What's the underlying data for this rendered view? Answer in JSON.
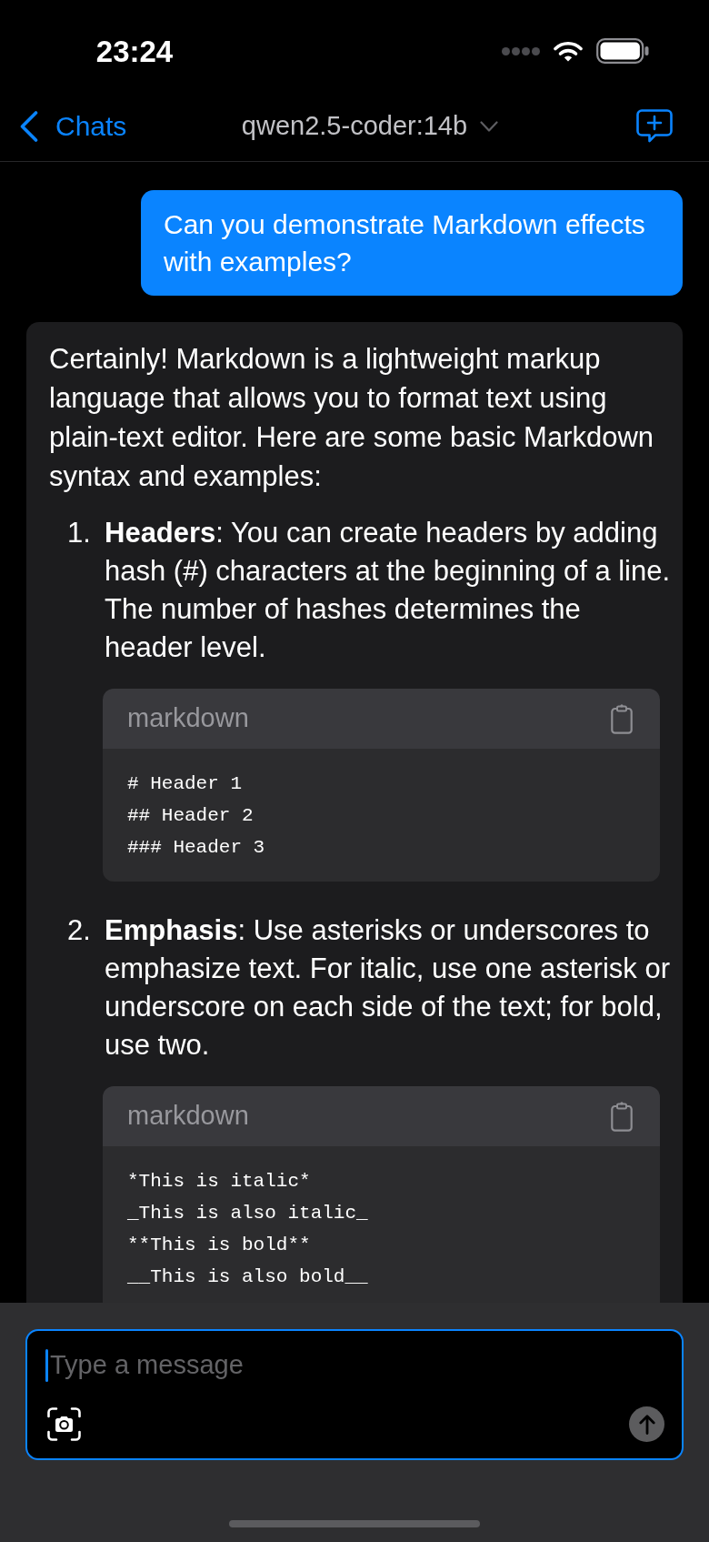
{
  "status_bar": {
    "time": "23:24"
  },
  "nav": {
    "back_label": "Chats",
    "title": "qwen2.5-coder:14b"
  },
  "messages": [
    {
      "kind": "user",
      "text": "Can you demonstrate Markdown effects with examples?"
    },
    {
      "kind": "assistant",
      "paragraphs": [
        "Certainly! Markdown is a lightweight markup language that allows you to format text using plain-text editor. Here are some basic Markdown syntax and examples:"
      ],
      "list": [
        {
          "number": "1.",
          "text": "**Headers**: You can create headers by adding hash (#) characters at the beginning of a line. The number of hashes determines the header level.",
          "code": {
            "language": "markdown",
            "lines": [
              "# Header 1",
              "## Header 2",
              "### Header 3"
            ]
          }
        },
        {
          "number": "2.",
          "text": "**Emphasis**: Use asterisks or underscores to emphasize text. For italic, use one asterisk or underscore on each side of the text; for bold, use two.",
          "code": {
            "language": "markdown",
            "lines": [
              "*This is italic*",
              "_This is also italic_",
              "**This is bold**",
              "__This is also bold__"
            ]
          }
        }
      ]
    }
  ],
  "composer": {
    "placeholder": "Type a message",
    "focused": true
  }
}
